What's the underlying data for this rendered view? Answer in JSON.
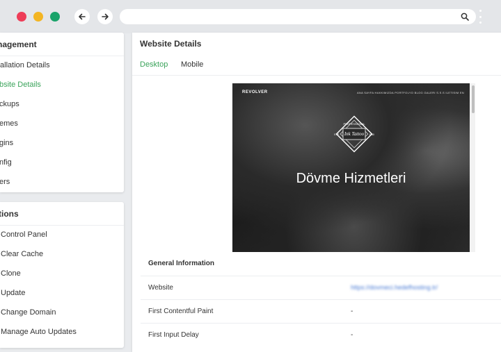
{
  "browser": {
    "window_controls": [
      "close",
      "minimize",
      "maximize"
    ],
    "nav_icons": [
      "arrow-left-icon",
      "arrow-right-icon"
    ],
    "address": "",
    "search_icon": "search-icon",
    "menu_icon": "kebab-menu-icon"
  },
  "sidebar": {
    "management": {
      "title": "nagement",
      "items": [
        {
          "label": "tallation Details",
          "active": false
        },
        {
          "label": "bsite Details",
          "active": true
        },
        {
          "label": "ckups",
          "active": false
        },
        {
          "label": "emes",
          "active": false
        },
        {
          "label": "gins",
          "active": false
        },
        {
          "label": "nfig",
          "active": false
        },
        {
          "label": "ers",
          "active": false
        }
      ]
    },
    "actions": {
      "title": "tions",
      "items": [
        {
          "label": "Control Panel"
        },
        {
          "label": "Clear Cache"
        },
        {
          "label": "Clone"
        },
        {
          "label": "Update"
        },
        {
          "label": "Change Domain"
        },
        {
          "label": "Manage Auto Updates"
        }
      ]
    }
  },
  "main": {
    "title": "Website Details",
    "tabs": [
      {
        "label": "Desktop",
        "active": true
      },
      {
        "label": "Mobile",
        "active": false
      }
    ],
    "preview": {
      "brand": "REVOLVER",
      "menu": "ANA SAYFA   HAKKIMIZDA   PORTFOLYO   BLOG   GALERI   S.S.S   ILETISIM   EN",
      "logo_text_top": "PROFESSIONAL",
      "logo_text_left": "ESP.",
      "logo_text_right": "1980",
      "heading": "Dövme Hizmetleri"
    },
    "general_info": {
      "title": "General Information",
      "rows": [
        {
          "label": "Website",
          "value": "https://dovmeci.hedefhosting.tr/",
          "is_link": true
        },
        {
          "label": "First Contentful Paint",
          "value": "-",
          "is_link": false
        },
        {
          "label": "First Input Delay",
          "value": "-",
          "is_link": false
        }
      ]
    }
  },
  "colors": {
    "accent_green": "#3aa35a",
    "dot_red": "#ee3d58",
    "dot_yellow": "#f3b523",
    "dot_green": "#1aa36a",
    "link_blue": "#4a7bd4"
  }
}
